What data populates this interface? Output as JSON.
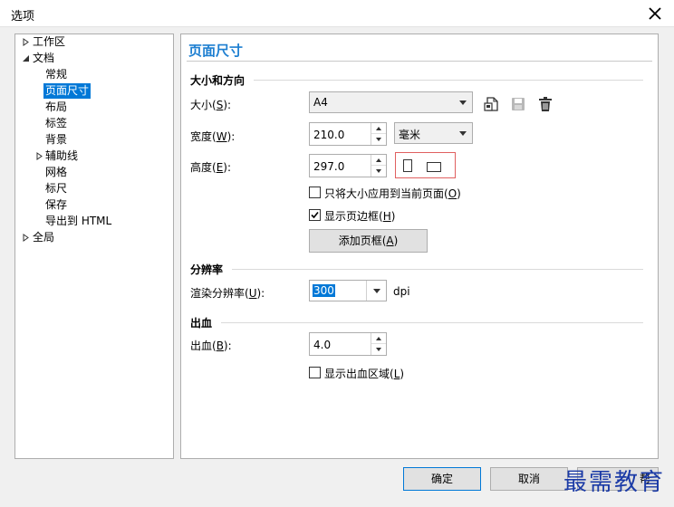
{
  "window": {
    "title": "选项"
  },
  "tree": {
    "items": [
      {
        "label": "工作区",
        "expander": "collapsed"
      },
      {
        "label": "文档",
        "expander": "expanded"
      },
      {
        "label": "常规"
      },
      {
        "label": "页面尺寸",
        "selected": true
      },
      {
        "label": "布局"
      },
      {
        "label": "标签"
      },
      {
        "label": "背景"
      },
      {
        "label": "辅助线",
        "expander": "collapsed"
      },
      {
        "label": "网格"
      },
      {
        "label": "标尺"
      },
      {
        "label": "保存"
      },
      {
        "label": "导出到 HTML"
      },
      {
        "label": "全局",
        "expander": "collapsed"
      }
    ]
  },
  "panel": {
    "title": "页面尺寸",
    "size_orientation": {
      "heading": "大小和方向",
      "size_label_pre": "大小(",
      "size_label_key": "S",
      "size_label_post": "):",
      "size_value": "A4",
      "width_label_pre": "宽度(",
      "width_label_key": "W",
      "width_label_post": "):",
      "width_value": "210.0",
      "unit_value": "毫米",
      "height_label_pre": "高度(",
      "height_label_key": "E",
      "height_label_post": "):",
      "height_value": "297.0",
      "apply_current_pre": "只将大小应用到当前页面(",
      "apply_current_key": "O",
      "apply_current_post": ")",
      "apply_current_checked": false,
      "show_border_pre": "显示页边框(",
      "show_border_key": "H",
      "show_border_post": ")",
      "show_border_checked": true,
      "add_border_pre": "添加页框(",
      "add_border_key": "A",
      "add_border_post": ")"
    },
    "resolution": {
      "heading": "分辨率",
      "render_label_pre": "渲染分辨率(",
      "render_label_key": "U",
      "render_label_post": "):",
      "render_value": "300",
      "unit": "dpi"
    },
    "bleed": {
      "heading": "出血",
      "bleed_label_pre": "出血(",
      "bleed_label_key": "B",
      "bleed_label_post": "):",
      "bleed_value": "4.0",
      "show_bleed_pre": "显示出血区域(",
      "show_bleed_key": "L",
      "show_bleed_post": ")",
      "show_bleed_checked": false
    }
  },
  "footer": {
    "ok_label": "确定",
    "cancel_label": "取消",
    "help_partial": "帮"
  },
  "watermark": {
    "text": "最需教育"
  },
  "colors": {
    "accent": "#0078d7",
    "title_blue": "#1e7fd1",
    "orientation_border": "#e06060"
  }
}
